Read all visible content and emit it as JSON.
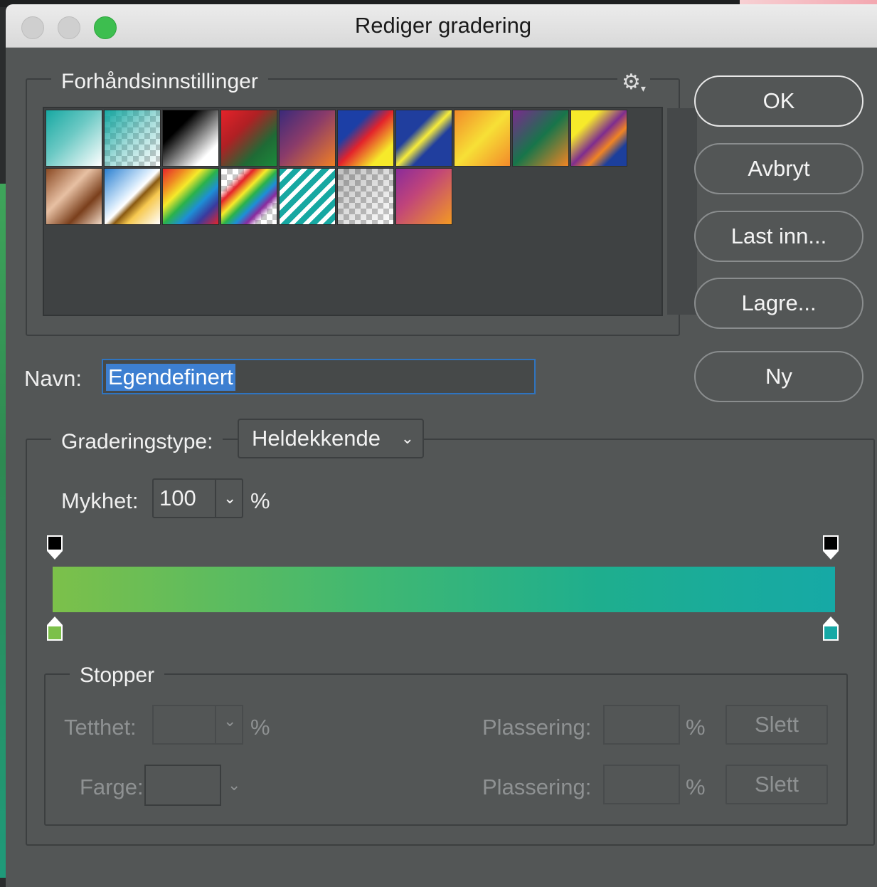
{
  "window": {
    "title": "Rediger gradering"
  },
  "presets": {
    "legend": "Forhåndsinnstillinger",
    "swatches": [
      {
        "name": "teal-to-white"
      },
      {
        "name": "teal-to-transparent"
      },
      {
        "name": "black-white"
      },
      {
        "name": "red-green"
      },
      {
        "name": "violet-orange"
      },
      {
        "name": "blue-red-yellow"
      },
      {
        "name": "blue-yellow-blue"
      },
      {
        "name": "orange-yellow-orange"
      },
      {
        "name": "violet-green-orange"
      },
      {
        "name": "yellow-violet-orange-blue"
      },
      {
        "name": "copper"
      },
      {
        "name": "chrome"
      },
      {
        "name": "spectrum"
      },
      {
        "name": "transparent-rainbow"
      },
      {
        "name": "transparent-stripes"
      },
      {
        "name": "neutral-density"
      },
      {
        "name": "violet-orange-2"
      }
    ]
  },
  "buttons": {
    "ok": "OK",
    "cancel": "Avbryt",
    "load": "Last inn...",
    "save": "Lagre...",
    "new": "Ny"
  },
  "name": {
    "label": "Navn:",
    "value": "Egendefinert"
  },
  "gradient": {
    "type_label": "Graderingstype:",
    "type_value": "Heldekkende",
    "smoothness_label": "Mykhet:",
    "smoothness_value": "100",
    "percent": "%",
    "color_stops": [
      "#7cc04a",
      "#16a9a6"
    ],
    "opacity_stops": [
      "#000000",
      "#000000"
    ]
  },
  "stops": {
    "legend": "Stopper",
    "opacity_label": "Tetthet:",
    "color_label": "Farge:",
    "location_label": "Plassering:",
    "percent": "%",
    "delete_label": "Slett"
  }
}
